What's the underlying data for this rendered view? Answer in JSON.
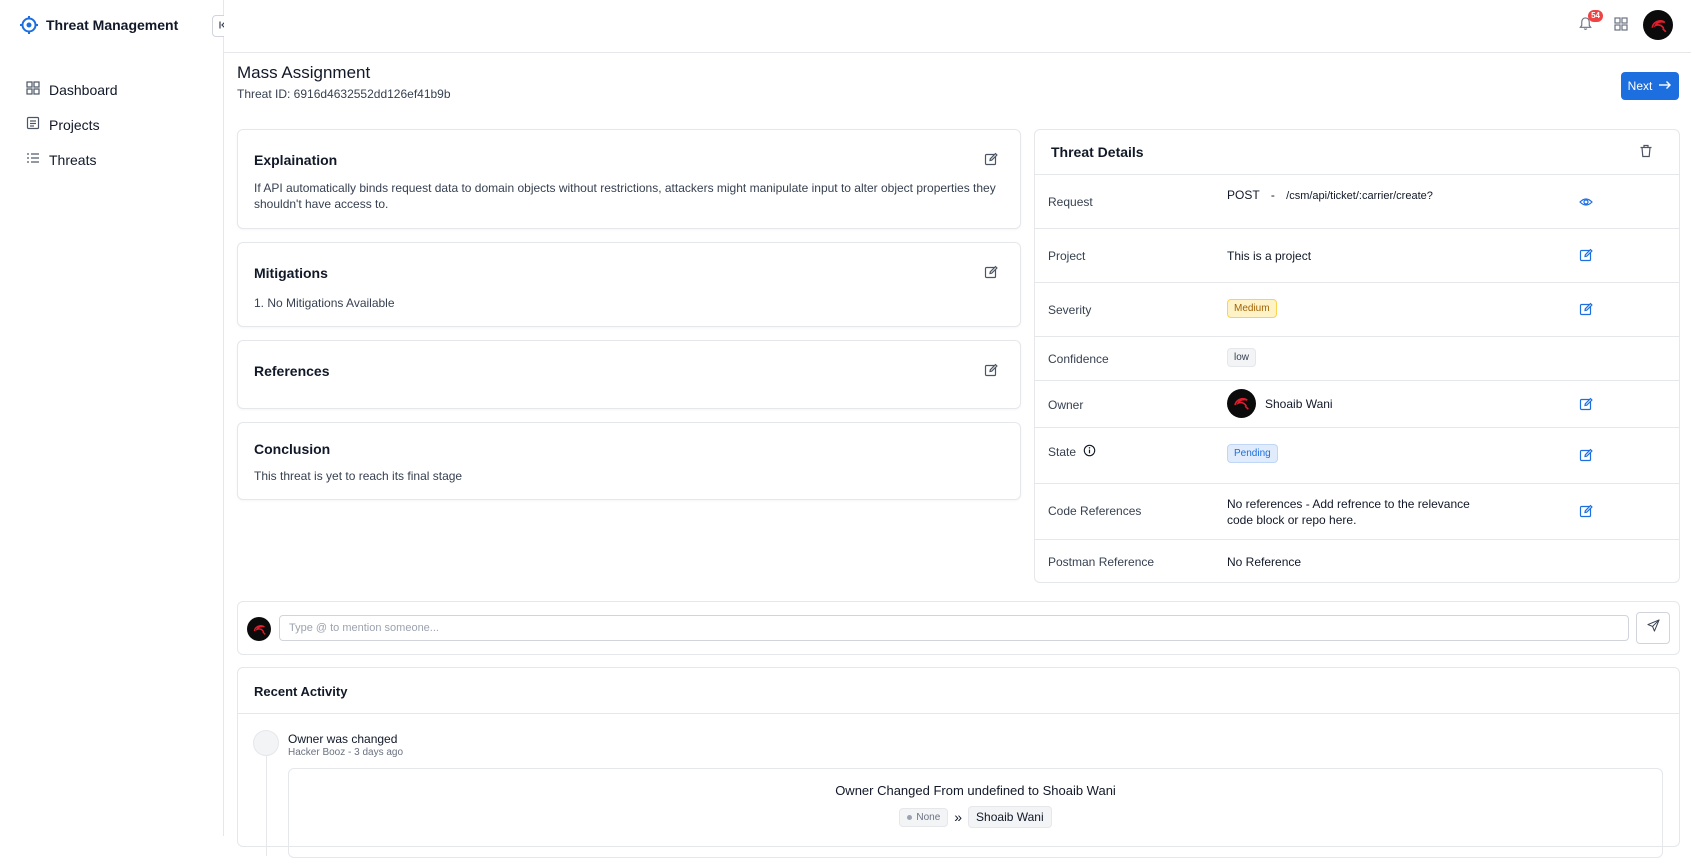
{
  "app": {
    "title": "Threat Management",
    "notifications_count": "54"
  },
  "sidebar": {
    "items": [
      {
        "label": "Dashboard",
        "icon": "dashboard-icon"
      },
      {
        "label": "Projects",
        "icon": "projects-icon"
      },
      {
        "label": "Threats",
        "icon": "threats-icon"
      }
    ]
  },
  "page": {
    "title": "Mass Assignment",
    "threat_id": "Threat ID: 6916d4632552dd126ef41b9b",
    "next_label": "Next"
  },
  "sections": {
    "explanation": {
      "title": "Explaination",
      "body": "If API automatically binds request data to domain objects without restrictions, attackers might manipulate input to alter object properties they shouldn't have access to."
    },
    "mitigations": {
      "title": "Mitigations",
      "body": "1. No Mitigations Available"
    },
    "references": {
      "title": "References",
      "body": ""
    },
    "conclusion": {
      "title": "Conclusion",
      "body": "This threat is yet to reach its final stage"
    }
  },
  "details": {
    "title": "Threat Details",
    "request_label": "Request",
    "request_method": "POST",
    "request_sep": "-",
    "request_path": "/csm/api/ticket/:carrier/create?",
    "project_label": "Project",
    "project_value": "This is a project",
    "severity_label": "Severity",
    "severity_value": "Medium",
    "confidence_label": "Confidence",
    "confidence_value": "low",
    "owner_label": "Owner",
    "owner_value": "Shoaib Wani",
    "state_label": "State",
    "state_value": "Pending",
    "code_refs_label": "Code References",
    "code_refs_value": "No references - Add refrence to the relevance code block or repo here.",
    "postman_label": "Postman Reference",
    "postman_value": "No Reference"
  },
  "comment": {
    "placeholder": "Type @ to mention someone..."
  },
  "activity": {
    "title": "Recent Activity",
    "items": [
      {
        "title": "Owner was changed",
        "meta": "Hacker Booz - 3 days ago",
        "change_text": "Owner Changed From undefined to Shoaib Wani",
        "from": "None",
        "arrow": "»",
        "to": "Shoaib Wani"
      }
    ]
  },
  "colors": {
    "accent": "#1d6fe0",
    "badge": "#ef4444",
    "medium": "#a16207",
    "pending": "#1d6fe0"
  }
}
